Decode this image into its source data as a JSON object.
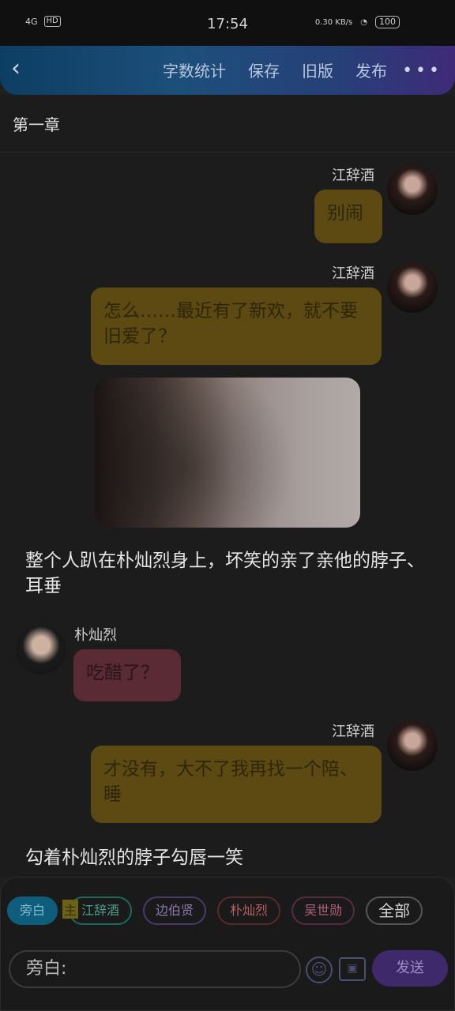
{
  "status": {
    "network": "4G",
    "hd": "HD",
    "time": "17:54",
    "speed": "0.30 KB/s",
    "battery": "100"
  },
  "nav": {
    "back_icon": "chevron-left",
    "actions": [
      "字数统计",
      "保存",
      "旧版",
      "发布"
    ],
    "more": "•••"
  },
  "chapter": "第一章",
  "messages": [
    {
      "speaker": "江辞酒",
      "text": "别闹"
    },
    {
      "speaker": "江辞酒",
      "text": "怎么……最近有了新欢，就不要旧爱了？"
    },
    {
      "narration": "整个人趴在朴灿烈身上，坏笑的亲了亲他的脖子、耳垂"
    },
    {
      "speaker": "朴灿烈",
      "text": "吃醋了？"
    },
    {
      "speaker": "江辞酒",
      "text": "才没有，大不了我再找一个陪、睡"
    },
    {
      "narration": "勾着朴灿烈的脖子勾唇一笑"
    }
  ],
  "bottom": {
    "chips": [
      "旁白",
      "江辞酒",
      "边伯贤",
      "朴灿烈",
      "吴世勋",
      "全部"
    ],
    "main_badge": "主",
    "input_placeholder": "旁白:",
    "emoji_icon": "smiley-icon",
    "image_icon": "image-icon",
    "send": "发送"
  },
  "colors": {
    "gold_bubble": "#5c4a12",
    "pink_bubble": "#5a2a35",
    "nav_start": "#0d3e63",
    "nav_end": "#3f2a78"
  }
}
